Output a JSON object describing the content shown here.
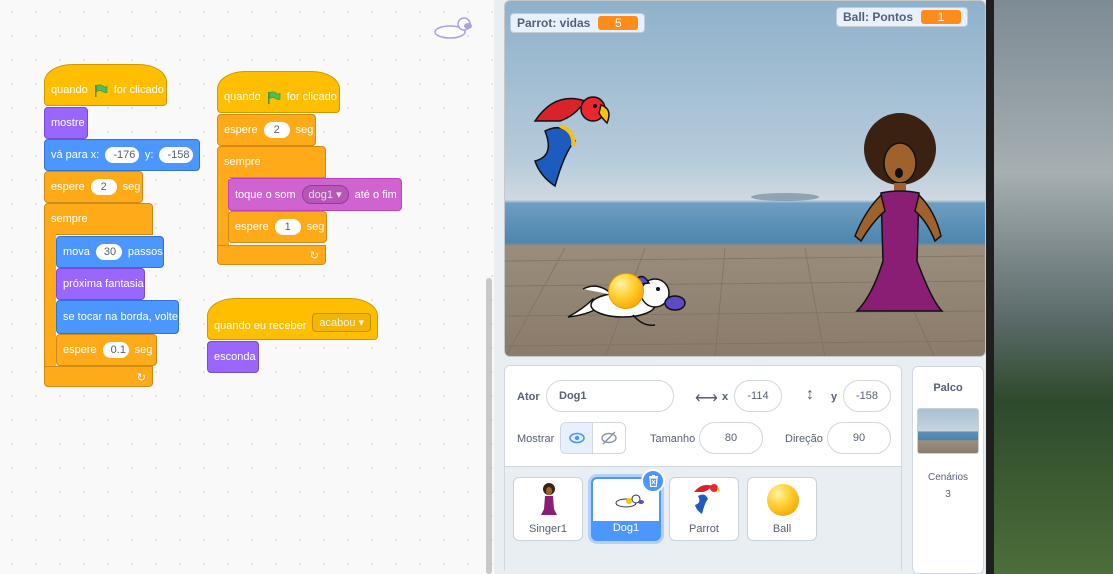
{
  "scripts": {
    "left": {
      "when_flag_clicked": [
        "quando",
        "for clicado"
      ],
      "show": "mostre",
      "go_to": {
        "prefix": "vá para x:",
        "x": "-176",
        "y_label": "y:",
        "y": "-158"
      },
      "wait": {
        "prefix": "espere",
        "value": "2",
        "suffix": "seg"
      },
      "forever": "sempre",
      "move": {
        "prefix": "mova",
        "value": "30",
        "suffix": "passos"
      },
      "next_costume": "próxima fantasia",
      "bounce": "se tocar na borda, volte",
      "wait_inner": {
        "prefix": "espere",
        "value": "0.1",
        "suffix": "seg"
      }
    },
    "middle": {
      "when_flag_clicked": [
        "quando",
        "for clicado"
      ],
      "wait": {
        "prefix": "espere",
        "value": "2",
        "suffix": "seg"
      },
      "forever": "sempre",
      "play_sound": {
        "prefix": "toque o som",
        "sound": "dog1",
        "suffix": "até o fim"
      },
      "wait_inner": {
        "prefix": "espere",
        "value": "1",
        "suffix": "seg"
      }
    },
    "broadcast": {
      "when_receive": "quando eu receber",
      "message": "acabou",
      "hide": "esconda"
    }
  },
  "stage": {
    "monitor_left": {
      "label": "Parrot: vidas",
      "value": "5"
    },
    "monitor_right": {
      "label": "Ball: Pontos",
      "value": "1"
    }
  },
  "sprite_info": {
    "sprite_label": "Ator",
    "sprite_name": "Dog1",
    "x_label": "x",
    "x": "-114",
    "y_label": "y",
    "y": "-158",
    "show_label": "Mostrar",
    "size_label": "Tamanho",
    "size": "80",
    "direction_label": "Direção",
    "direction": "90"
  },
  "sprites": [
    {
      "name": "Singer1"
    },
    {
      "name": "Dog1",
      "selected": true
    },
    {
      "name": "Parrot"
    },
    {
      "name": "Ball"
    }
  ],
  "stage_panel": {
    "title": "Palco",
    "backdrops_label": "Cenários",
    "backdrops_count": "3"
  },
  "colors": {
    "events": "#ffbf00",
    "control": "#ffab19",
    "looks": "#9966ff",
    "motion": "#4c97ff",
    "sound": "#cf63cf",
    "monitor_value": "#ff8c1a"
  }
}
